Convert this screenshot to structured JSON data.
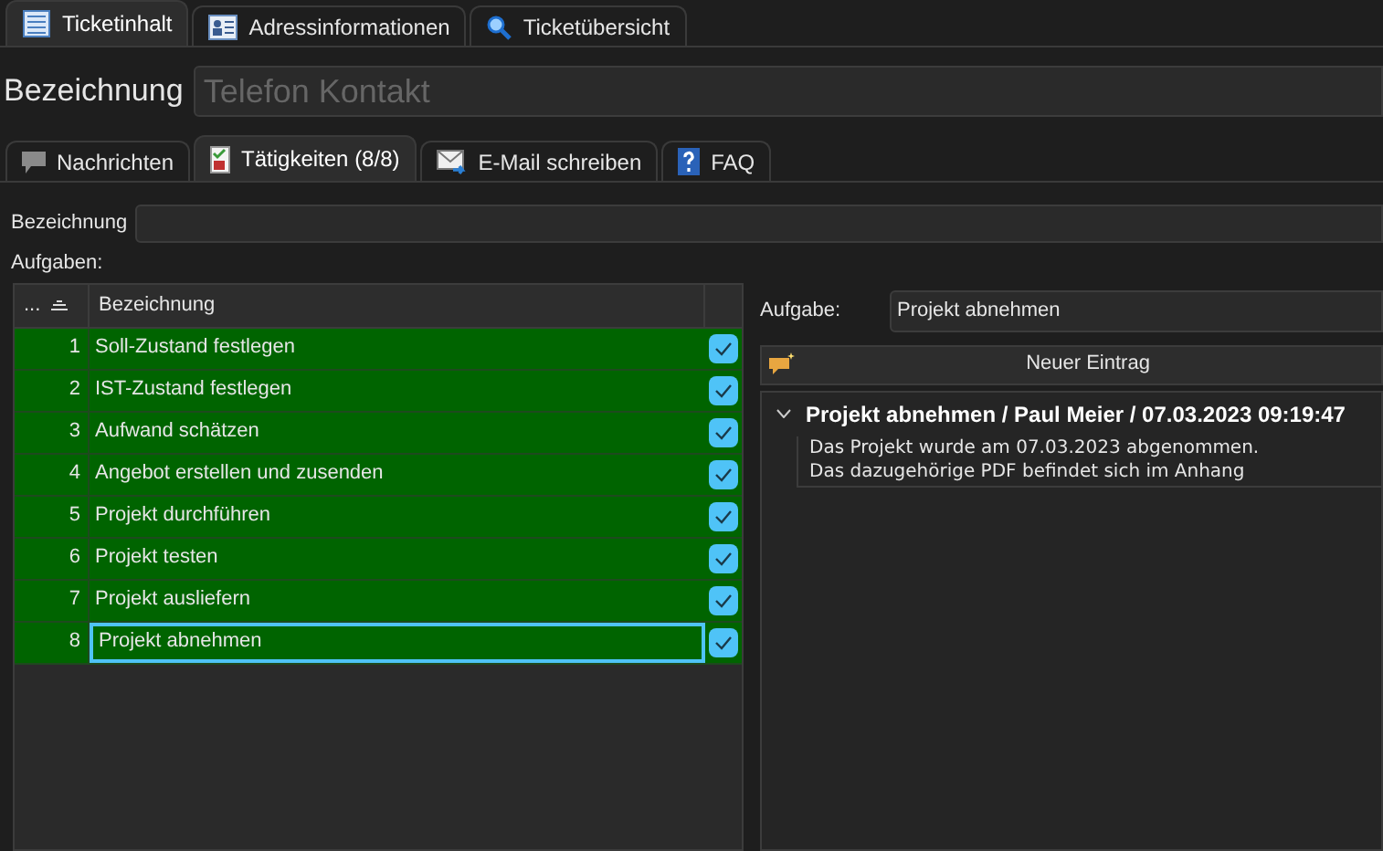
{
  "main_tabs": [
    {
      "label": "Ticketinhalt",
      "kind": "document",
      "selected": true
    },
    {
      "label": "Adressinformationen",
      "kind": "card",
      "selected": false
    },
    {
      "label": "Ticketübersicht",
      "kind": "search",
      "selected": false
    }
  ],
  "title_label": "Bezeichnung",
  "title_placeholder": "Telefon Kontakt",
  "sub_tabs": [
    {
      "label": "Nachrichten",
      "kind": "bubble",
      "selected": false
    },
    {
      "label": "Tätigkeiten (8/8)",
      "kind": "checklist",
      "selected": true
    },
    {
      "label": "E-Mail schreiben",
      "kind": "mail",
      "selected": false
    },
    {
      "label": "FAQ",
      "kind": "help",
      "selected": false
    }
  ],
  "filter_label": "Bezeichnung",
  "tasks_label": "Aufgaben:",
  "table": {
    "columns": [
      "...",
      "Bezeichnung"
    ],
    "rows": [
      {
        "number": "1",
        "name": "Soll-Zustand festlegen",
        "checked": true,
        "selected": false
      },
      {
        "number": "2",
        "name": "IST-Zustand festlegen",
        "checked": true,
        "selected": false
      },
      {
        "number": "3",
        "name": "Aufwand schätzen",
        "checked": true,
        "selected": false
      },
      {
        "number": "4",
        "name": "Angebot erstellen und zusenden",
        "checked": true,
        "selected": false
      },
      {
        "number": "5",
        "name": "Projekt durchführen",
        "checked": true,
        "selected": false
      },
      {
        "number": "6",
        "name": "Projekt testen",
        "checked": true,
        "selected": false
      },
      {
        "number": "7",
        "name": "Projekt ausliefern",
        "checked": true,
        "selected": false
      },
      {
        "number": "8",
        "name": "Projekt abnehmen",
        "checked": true,
        "selected": true
      }
    ]
  },
  "task_label": "Aufgabe:",
  "task_value": "Projekt abnehmen",
  "new_entry_button": "Neuer Eintrag",
  "entries": [
    {
      "header": "Projekt abnehmen / Paul Meier / 07.03.2023 09:19:47",
      "expanded": true,
      "lines": [
        "Das Projekt wurde am 07.03.2023 abgenommen.",
        "Das dazugehörige PDF befindet sich im Anhang"
      ]
    }
  ]
}
